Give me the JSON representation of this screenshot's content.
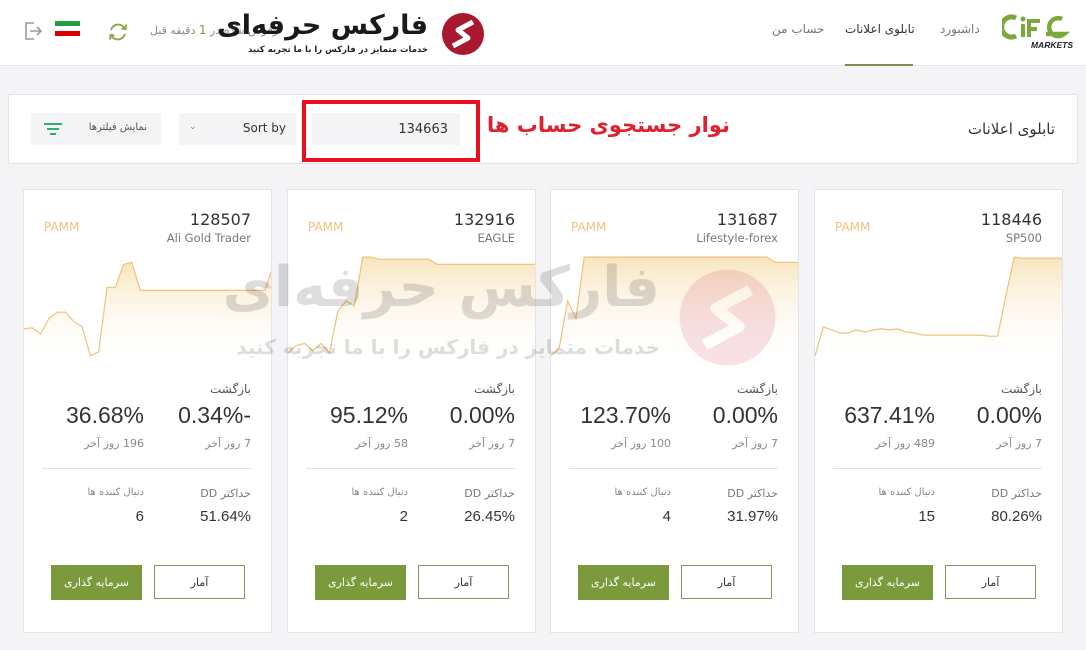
{
  "header": {
    "refresh_text_prefix": "رفرش شده در",
    "refresh_minutes": "1",
    "refresh_text_suffix": "دقیقه قبل",
    "brand_title": "فارکس حرفه‌ای",
    "brand_subtitle": "خدمات متمایز در فارکس را با ما تجربه کنید",
    "nav": [
      {
        "label": "داشبورد",
        "active": false
      },
      {
        "label": "تابلوی اعلانات",
        "active": true
      },
      {
        "label": "حساب من",
        "active": false
      }
    ],
    "ifc_logo_text": "MARKETS",
    "icons": {
      "logout": "logout-icon",
      "flag": "iran-flag-icon",
      "refresh": "refresh-icon"
    }
  },
  "panel": {
    "title": "تابلوی اعلانات",
    "annotation": "نوار جستجوی حساب ها",
    "search_value": "134663",
    "sort_label": "Sort by",
    "filter_label": "نمایش فیلترها"
  },
  "watermark": {
    "title": "فارکس حرفه‌ای",
    "subtitle": "خدمات متمایز در فارکس را با ما تجربه کنید"
  },
  "colors": {
    "accent_green": "#7b9a3b",
    "spark_line": "#f0c27a",
    "annotation_red": "#e8101f"
  },
  "cards": [
    {
      "type": "PAMM",
      "id": "118446",
      "name": "SP500",
      "return_label": "بازگشت",
      "return_7d": "0.00%",
      "return_7d_period": "7 روز آخر",
      "return_total": "637.41%",
      "return_total_period": "489 روز آخر",
      "dd_label": "حداکثر DD",
      "dd_value": "80.26%",
      "followers_label": "دنبال کننده ها",
      "followers": "15",
      "invest_label": "سرمایه گذاری",
      "stats_label": "آمار",
      "spark": [
        2,
        30,
        27,
        24,
        24,
        27,
        25,
        27,
        28,
        27,
        28,
        25,
        24,
        22,
        22,
        22,
        22,
        22,
        22,
        22,
        22,
        21,
        21,
        60,
        97,
        96,
        96,
        96,
        96,
        96,
        96
      ]
    },
    {
      "type": "PAMM",
      "id": "131687",
      "name": "Lifestyle-forex",
      "return_label": "بازگشت",
      "return_7d": "0.00%",
      "return_7d_period": "7 روز آخر",
      "return_total": "123.70%",
      "return_total_period": "100 روز آخر",
      "dd_label": "حداکثر DD",
      "dd_value": "31.97%",
      "followers_label": "دنبال کننده ها",
      "followers": "4",
      "invest_label": "سرمایه گذاری",
      "stats_label": "آمار",
      "spark": [
        2,
        10,
        55,
        38,
        97,
        97,
        97,
        97,
        97,
        97,
        97,
        97,
        97,
        97,
        97,
        97,
        97,
        97,
        97,
        97,
        97,
        97,
        97,
        97,
        97,
        97,
        97,
        92,
        92,
        92,
        92
      ]
    },
    {
      "type": "PAMM",
      "id": "132916",
      "name": "EAGLE",
      "return_label": "بازگشت",
      "return_7d": "0.00%",
      "return_7d_period": "7 روز آخر",
      "return_total": "95.12%",
      "return_total_period": "58 روز آخر",
      "dd_label": "حداکثر DD",
      "dd_value": "26.45%",
      "followers_label": "دنبال کننده ها",
      "followers": "2",
      "invest_label": "سرمایه گذاری",
      "stats_label": "آمار",
      "spark": [
        5,
        12,
        14,
        7,
        14,
        5,
        45,
        55,
        50,
        97,
        97,
        95,
        95,
        95,
        95,
        95,
        95,
        95,
        90,
        90,
        90,
        90,
        90,
        90,
        90,
        90,
        90,
        90,
        90,
        90,
        90
      ]
    },
    {
      "type": "PAMM",
      "id": "128507",
      "name": "Ali Gold Trader",
      "return_label": "بازگشت",
      "return_7d": "0.34%-",
      "return_7d_period": "7 روز آخر",
      "return_total": "36.68%",
      "return_total_period": "196 روز آخر",
      "dd_label": "حداکثر DD",
      "dd_value": "51.64%",
      "followers_label": "دنبال کننده ها",
      "followers": "6",
      "invest_label": "سرمایه گذاری",
      "stats_label": "آمار",
      "spark": [
        28,
        29,
        23,
        38,
        44,
        44,
        35,
        30,
        2,
        6,
        68,
        68,
        90,
        92,
        65,
        65,
        65,
        65,
        65,
        65,
        65,
        65,
        65,
        65,
        65,
        65,
        65,
        65,
        65,
        65,
        88
      ]
    }
  ]
}
